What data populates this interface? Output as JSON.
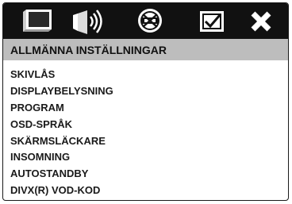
{
  "tabs": [
    {
      "icon": "tv-screen-icon"
    },
    {
      "icon": "speaker-sound-icon"
    },
    {
      "icon": "disc-settings-icon"
    },
    {
      "icon": "checked-box-icon"
    },
    {
      "icon": "close-icon"
    }
  ],
  "section": {
    "title": "ALLMÄNNA INSTÄLLNINGAR"
  },
  "menu": {
    "items": [
      {
        "label": "SKIVLÅS"
      },
      {
        "label": "DISPLAYBELYSNING"
      },
      {
        "label": "PROGRAM"
      },
      {
        "label": "OSD-SPRÅK"
      },
      {
        "label": "SKÄRMSLÄCKARE"
      },
      {
        "label": "INSOMNING"
      },
      {
        "label": "AUTOSTANDBY"
      },
      {
        "label": "DIVX(R) VOD-KOD"
      }
    ]
  },
  "colors": {
    "tabbar_bg": "#111111",
    "section_bg": "#bdbdbd",
    "text": "#1a1a1a",
    "icon_fill": "#ffffff"
  }
}
